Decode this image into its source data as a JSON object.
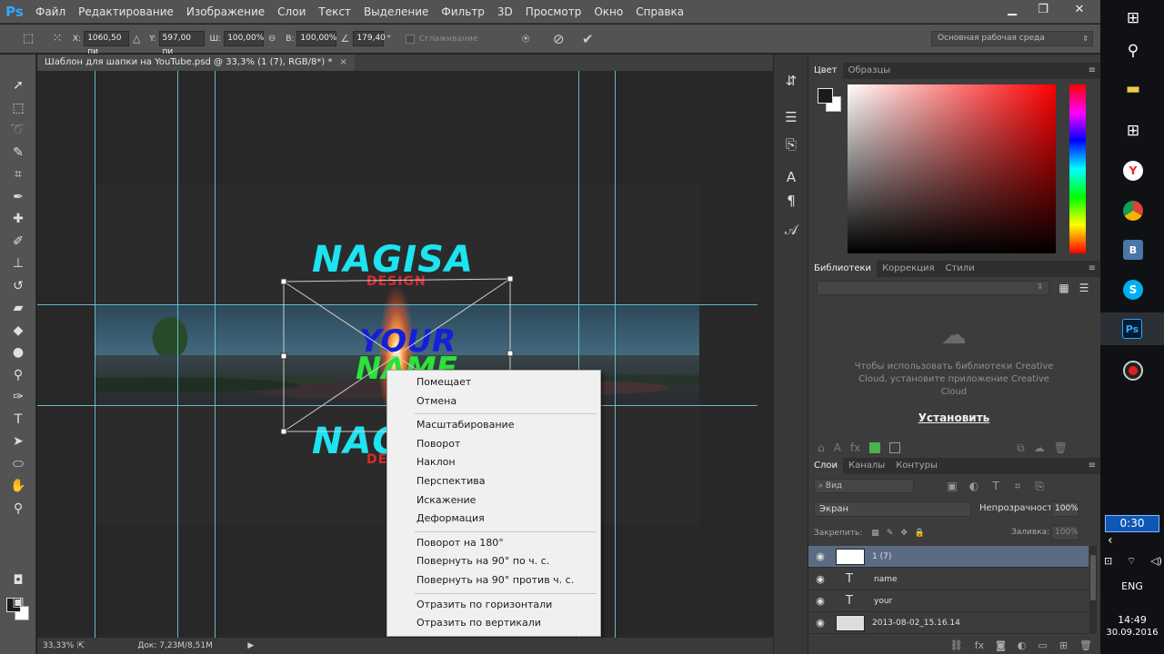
{
  "app": {
    "logo": "Ps",
    "menu": [
      "Файл",
      "Редактирование",
      "Изображение",
      "Слои",
      "Текст",
      "Выделение",
      "Фильтр",
      "3D",
      "Просмотр",
      "Окно",
      "Справка"
    ],
    "window_controls": {
      "minimize": "▁",
      "restore": "❐",
      "close": "✕"
    }
  },
  "options_bar": {
    "x_label": "X:",
    "x_value": "1060,50 пи",
    "y_label": "Y:",
    "y_value": "597,00 пи",
    "w_label": "Ш:",
    "w_value": "100,00%",
    "h_label": "В:",
    "h_value": "100,00%",
    "angle_value": "179,40",
    "angle_unit": "°",
    "antialias_label": "Сглаживание",
    "workspace": "Основная рабочая среда"
  },
  "document": {
    "tab_title": "Шаблон для шапки на YouTube.psd @ 33,3% (1 (7), RGB/8*) *",
    "tab_close": "×",
    "art": {
      "top_title": "NAGISA",
      "top_sub": "DESIGN",
      "your": "YOUR",
      "name": "NAME",
      "bottom_title": "NAGISA",
      "bottom_sub": "DESIGN"
    }
  },
  "context_menu": {
    "group1": [
      "Помещает",
      "Отмена"
    ],
    "group2": [
      "Масштабирование",
      "Поворот",
      "Наклон",
      "Перспектива",
      "Искажение",
      "Деформация"
    ],
    "group3": [
      "Поворот на 180°",
      "Повернуть на 90° по ч. с.",
      "Повернуть на 90° против ч. с."
    ],
    "group4": [
      "Отразить по горизонтали",
      "Отразить по вертикали"
    ]
  },
  "status_bar": {
    "zoom": "33,33%",
    "doc": "Док: 7,23M/8,51M",
    "arrow": "▶"
  },
  "color_panel": {
    "tabs": [
      "Цвет",
      "Образцы"
    ]
  },
  "libraries_panel": {
    "tabs": [
      "Библиотеки",
      "Коррекция",
      "Стили"
    ],
    "message": "Чтобы использовать библиотеки Creative Cloud, установите приложение Creative Cloud",
    "install": "Установить"
  },
  "layers_panel": {
    "tabs": [
      "Слои",
      "Каналы",
      "Контуры"
    ],
    "kind": "Вид",
    "blend_mode": "Экран",
    "opacity_label": "Непрозрачность:",
    "opacity_value": "100%",
    "lock_label": "Закрепить:",
    "fill_label": "Заливка:",
    "fill_value": "100%",
    "layers": [
      {
        "name": "1 (7)",
        "type": "image",
        "selected": true
      },
      {
        "name": "name",
        "type": "text",
        "selected": false
      },
      {
        "name": "your",
        "type": "text",
        "selected": false
      },
      {
        "name": "2013-08-02_15.16.14",
        "type": "image",
        "selected": false
      }
    ]
  },
  "taskbar": {
    "timer": "0:30",
    "lang": "ENG",
    "time": "14:49",
    "date": "30.09.2016",
    "vk": "В",
    "skype": "S",
    "ps": "Ps",
    "yandex": "Y"
  },
  "colors": {
    "accent_selection": "#5c6b84",
    "guide": "#6ec6d8",
    "nagisa": "#1ee3f0",
    "design": "#d9292d",
    "your": "#1420d8",
    "name": "#2de03a"
  }
}
